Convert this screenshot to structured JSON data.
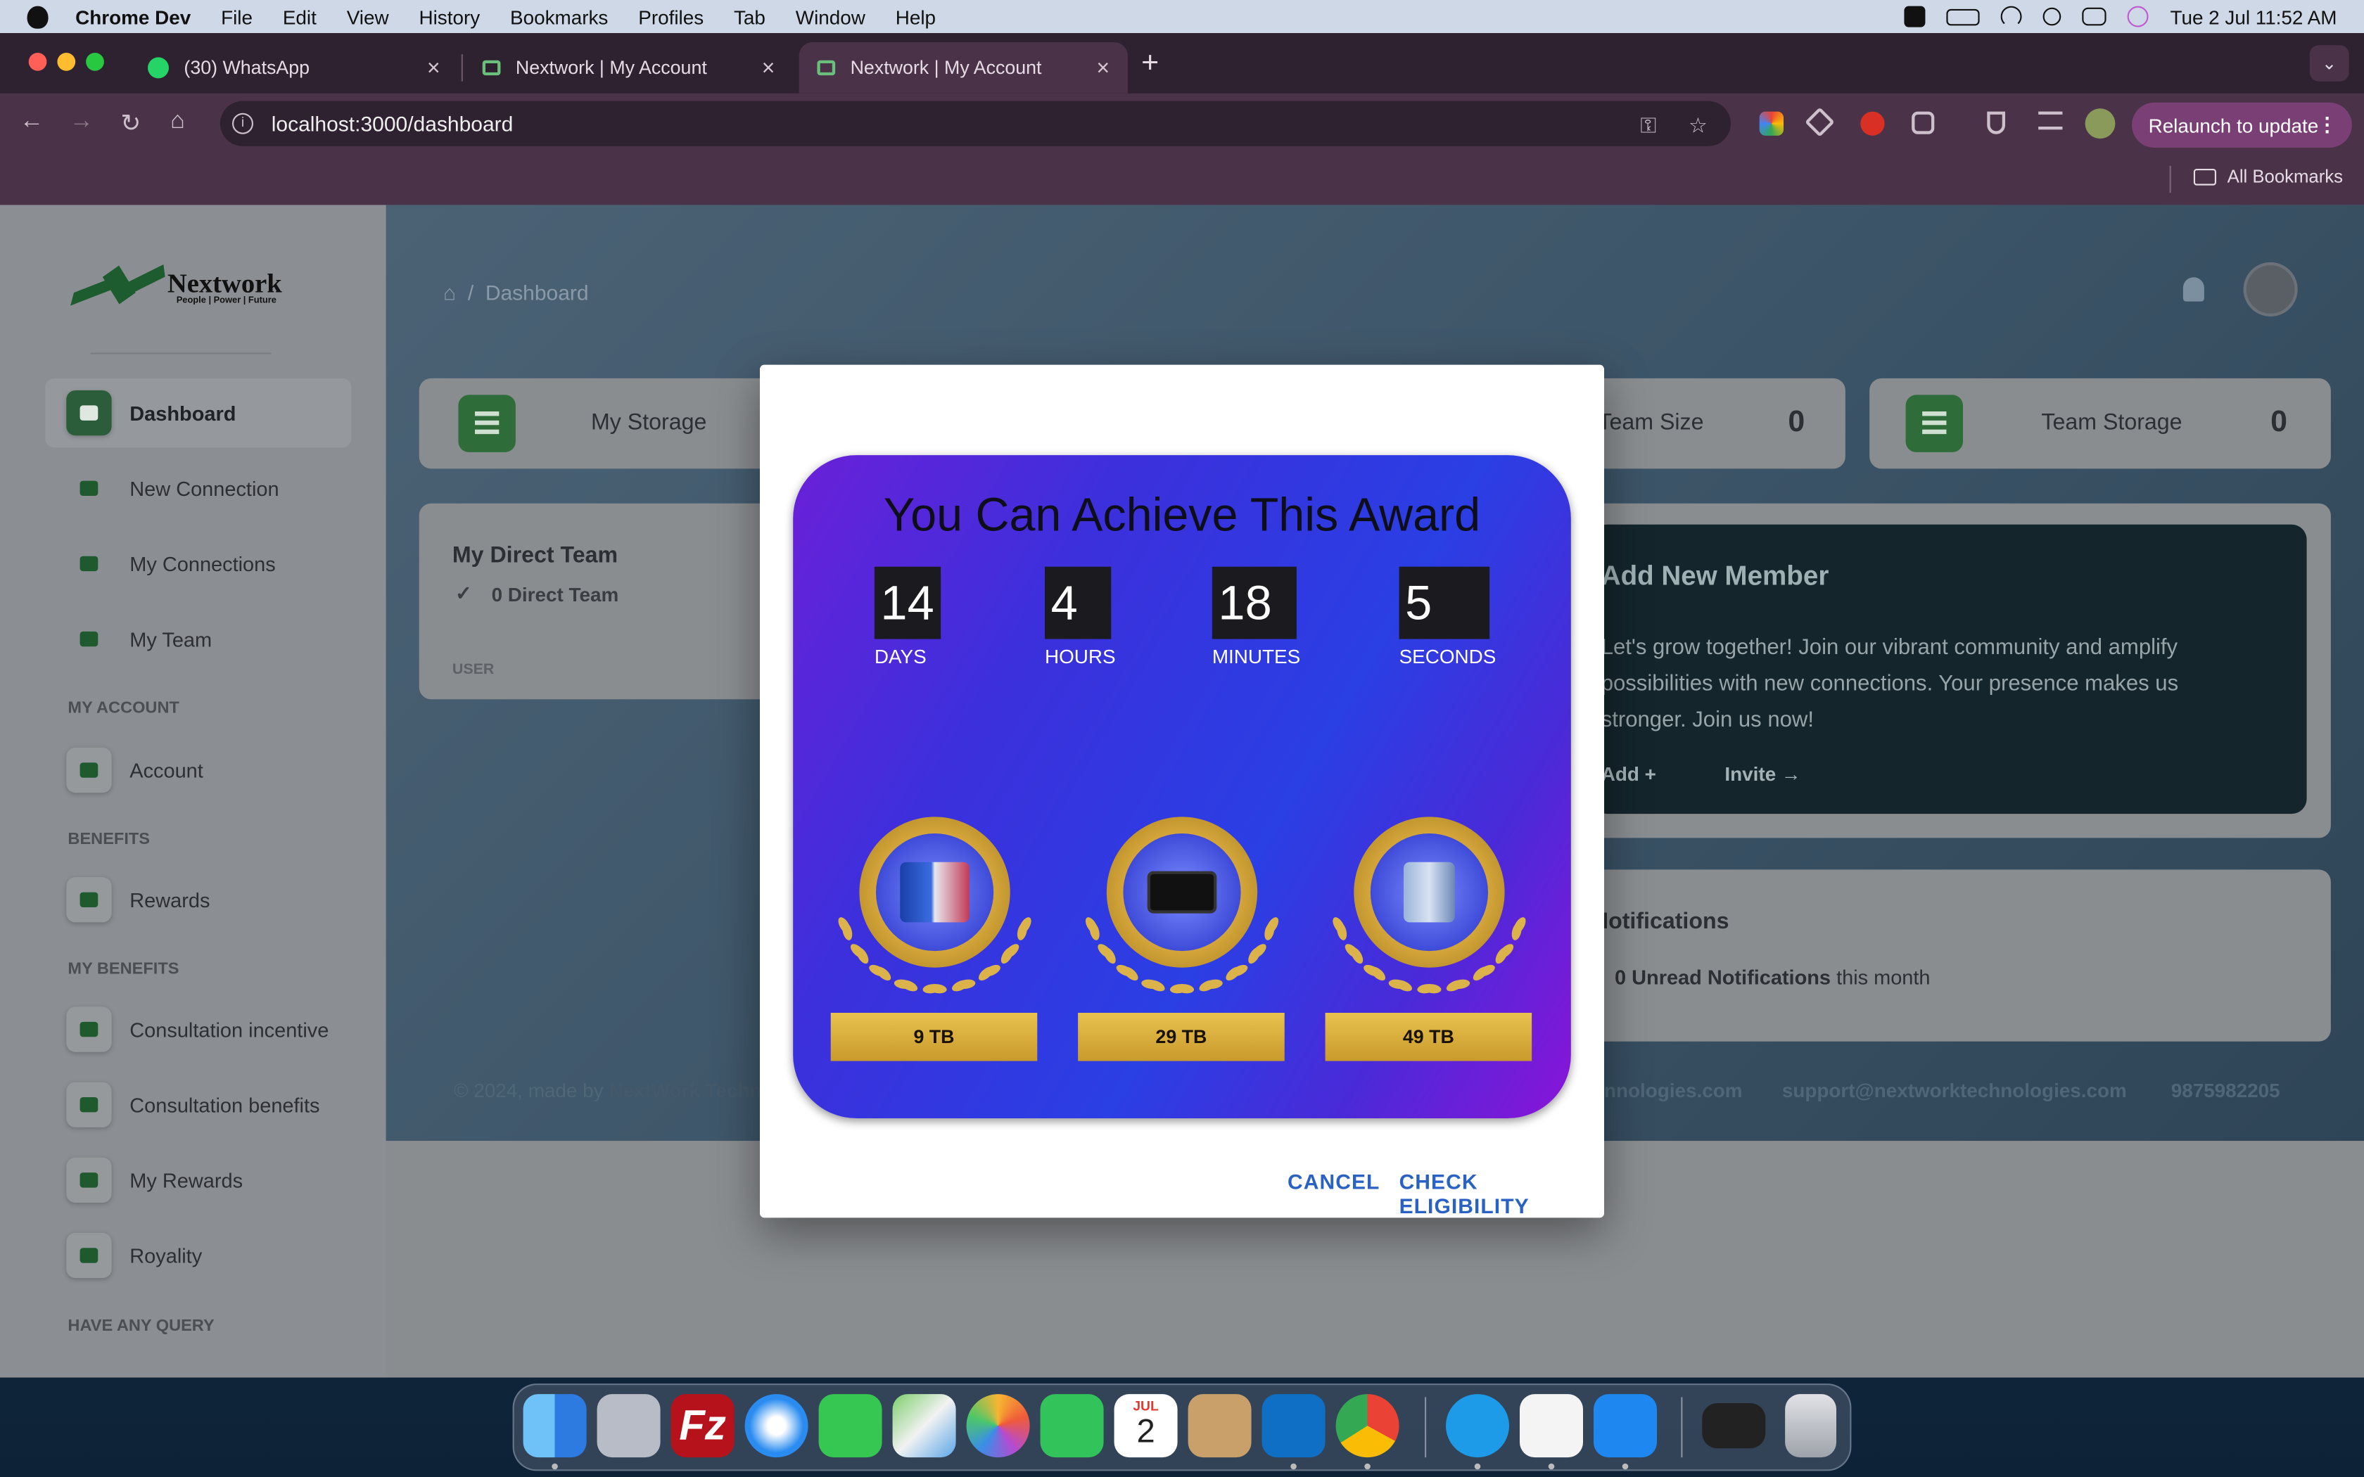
{
  "menubar": {
    "app": "Chrome Dev",
    "items": [
      "File",
      "Edit",
      "View",
      "History",
      "Bookmarks",
      "Profiles",
      "Tab",
      "Window",
      "Help"
    ],
    "datetime": "Tue 2 Jul  11:52 AM"
  },
  "browser": {
    "tabs": [
      {
        "title": "(30) WhatsApp"
      },
      {
        "title": "Nextwork | My Account"
      },
      {
        "title": "Nextwork | My Account"
      }
    ],
    "url": "localhost:3000/dashboard",
    "relaunch_label": "Relaunch to update",
    "bookmarks_label": "All Bookmarks"
  },
  "sidebar": {
    "brand": "Nextwork",
    "tagline": "People | Power | Future",
    "items": [
      {
        "label": "Dashboard"
      },
      {
        "label": "New Connection"
      },
      {
        "label": "My Connections"
      },
      {
        "label": "My Team"
      },
      {
        "label": "Account"
      },
      {
        "label": "Rewards"
      },
      {
        "label": "Consultation incentive"
      },
      {
        "label": "Consultation benefits"
      },
      {
        "label": "My Rewards"
      },
      {
        "label": "Royality"
      }
    ],
    "sections": [
      "MY ACCOUNT",
      "BENEFITS",
      "MY BENEFITS",
      "HAVE ANY QUERY"
    ]
  },
  "main": {
    "breadcrumb": "Dashboard",
    "cards": {
      "my_storage": "My Storage",
      "team_size_label": "Team Size",
      "team_size_value": "0",
      "team_storage_label": "Team Storage",
      "team_storage_value": "0"
    },
    "direct_team": {
      "title": "My Direct Team",
      "count": "0 Direct Team",
      "col": "USER"
    },
    "add_member": {
      "title": "Add New Member",
      "text": "Let's grow together! Join our vibrant community and amplify possibilities with new connections. Your presence makes us stronger. Join us now!",
      "add": "Add +",
      "invite": "Invite →"
    },
    "notifications": {
      "title": "Notifications",
      "count": "0 Unread Notifications",
      "suffix": " this month"
    },
    "footer": {
      "left_prefix": "© 2024, made by ",
      "left_brand": "NextWork Techn",
      "site": "nnologies.com",
      "email": "support@nextworktechnologies.com",
      "phone": "9875982205"
    }
  },
  "modal": {
    "title": "You Can Achieve This Award",
    "countdown": [
      {
        "value": "14",
        "unit": "DAYS"
      },
      {
        "value": "4",
        "unit": "HOURS"
      },
      {
        "value": "18",
        "unit": "MINUTES"
      },
      {
        "value": "5",
        "unit": "SECONDS"
      }
    ],
    "awards": [
      {
        "label": "9 TB",
        "prize": "smartphones"
      },
      {
        "label": "29 TB",
        "prize": "television"
      },
      {
        "label": "49 TB",
        "prize": "iphone"
      }
    ],
    "cancel": "CANCEL",
    "check": "CHECK ELIGIBILITY"
  },
  "dock": {
    "calendar_month": "JUL",
    "calendar_day": "2",
    "apps": [
      "finder",
      "launchpad",
      "filezilla",
      "safari",
      "messages",
      "maps",
      "photos",
      "facetime",
      "calendar",
      "contacts",
      "vscode",
      "chrome",
      "skype",
      "mongodb",
      "app-store",
      "screenshot",
      "trash"
    ]
  },
  "colors": {
    "accent": "#2a62c4",
    "brand_green": "#1d5c2e",
    "award_gold": "#d3a53a"
  }
}
